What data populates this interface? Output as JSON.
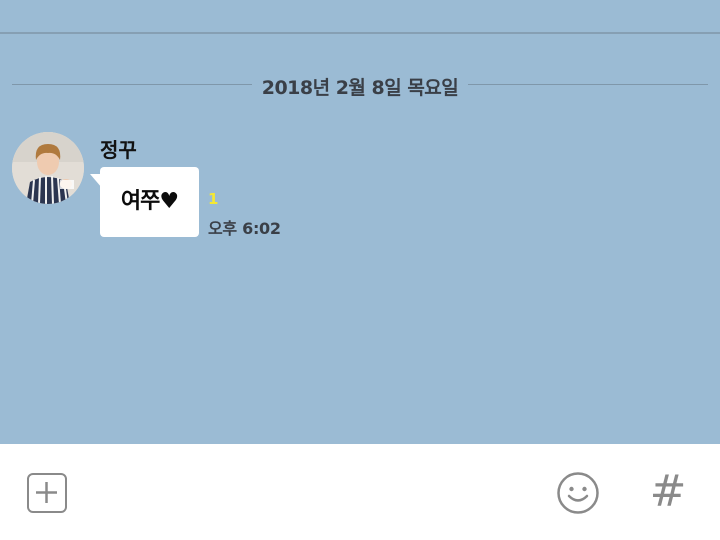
{
  "colors": {
    "chat_background": "#9bbbd4",
    "bubble": "#ffffff",
    "unread": "#f4e834",
    "input_bar": "#ffffff",
    "icon_gray": "#8a8a8a"
  },
  "chat": {
    "date_divider": "2018년 2월 8일 목요일",
    "messages": [
      {
        "sender": "정꾸",
        "text": "여쭈♥",
        "unread_count": "1",
        "time": "오후 6:02",
        "avatar_icon": "profile-photo"
      }
    ]
  },
  "input_bar": {
    "add_icon": "plus-square-icon",
    "emoji_icon": "smiley-icon",
    "hash_label": "#"
  }
}
